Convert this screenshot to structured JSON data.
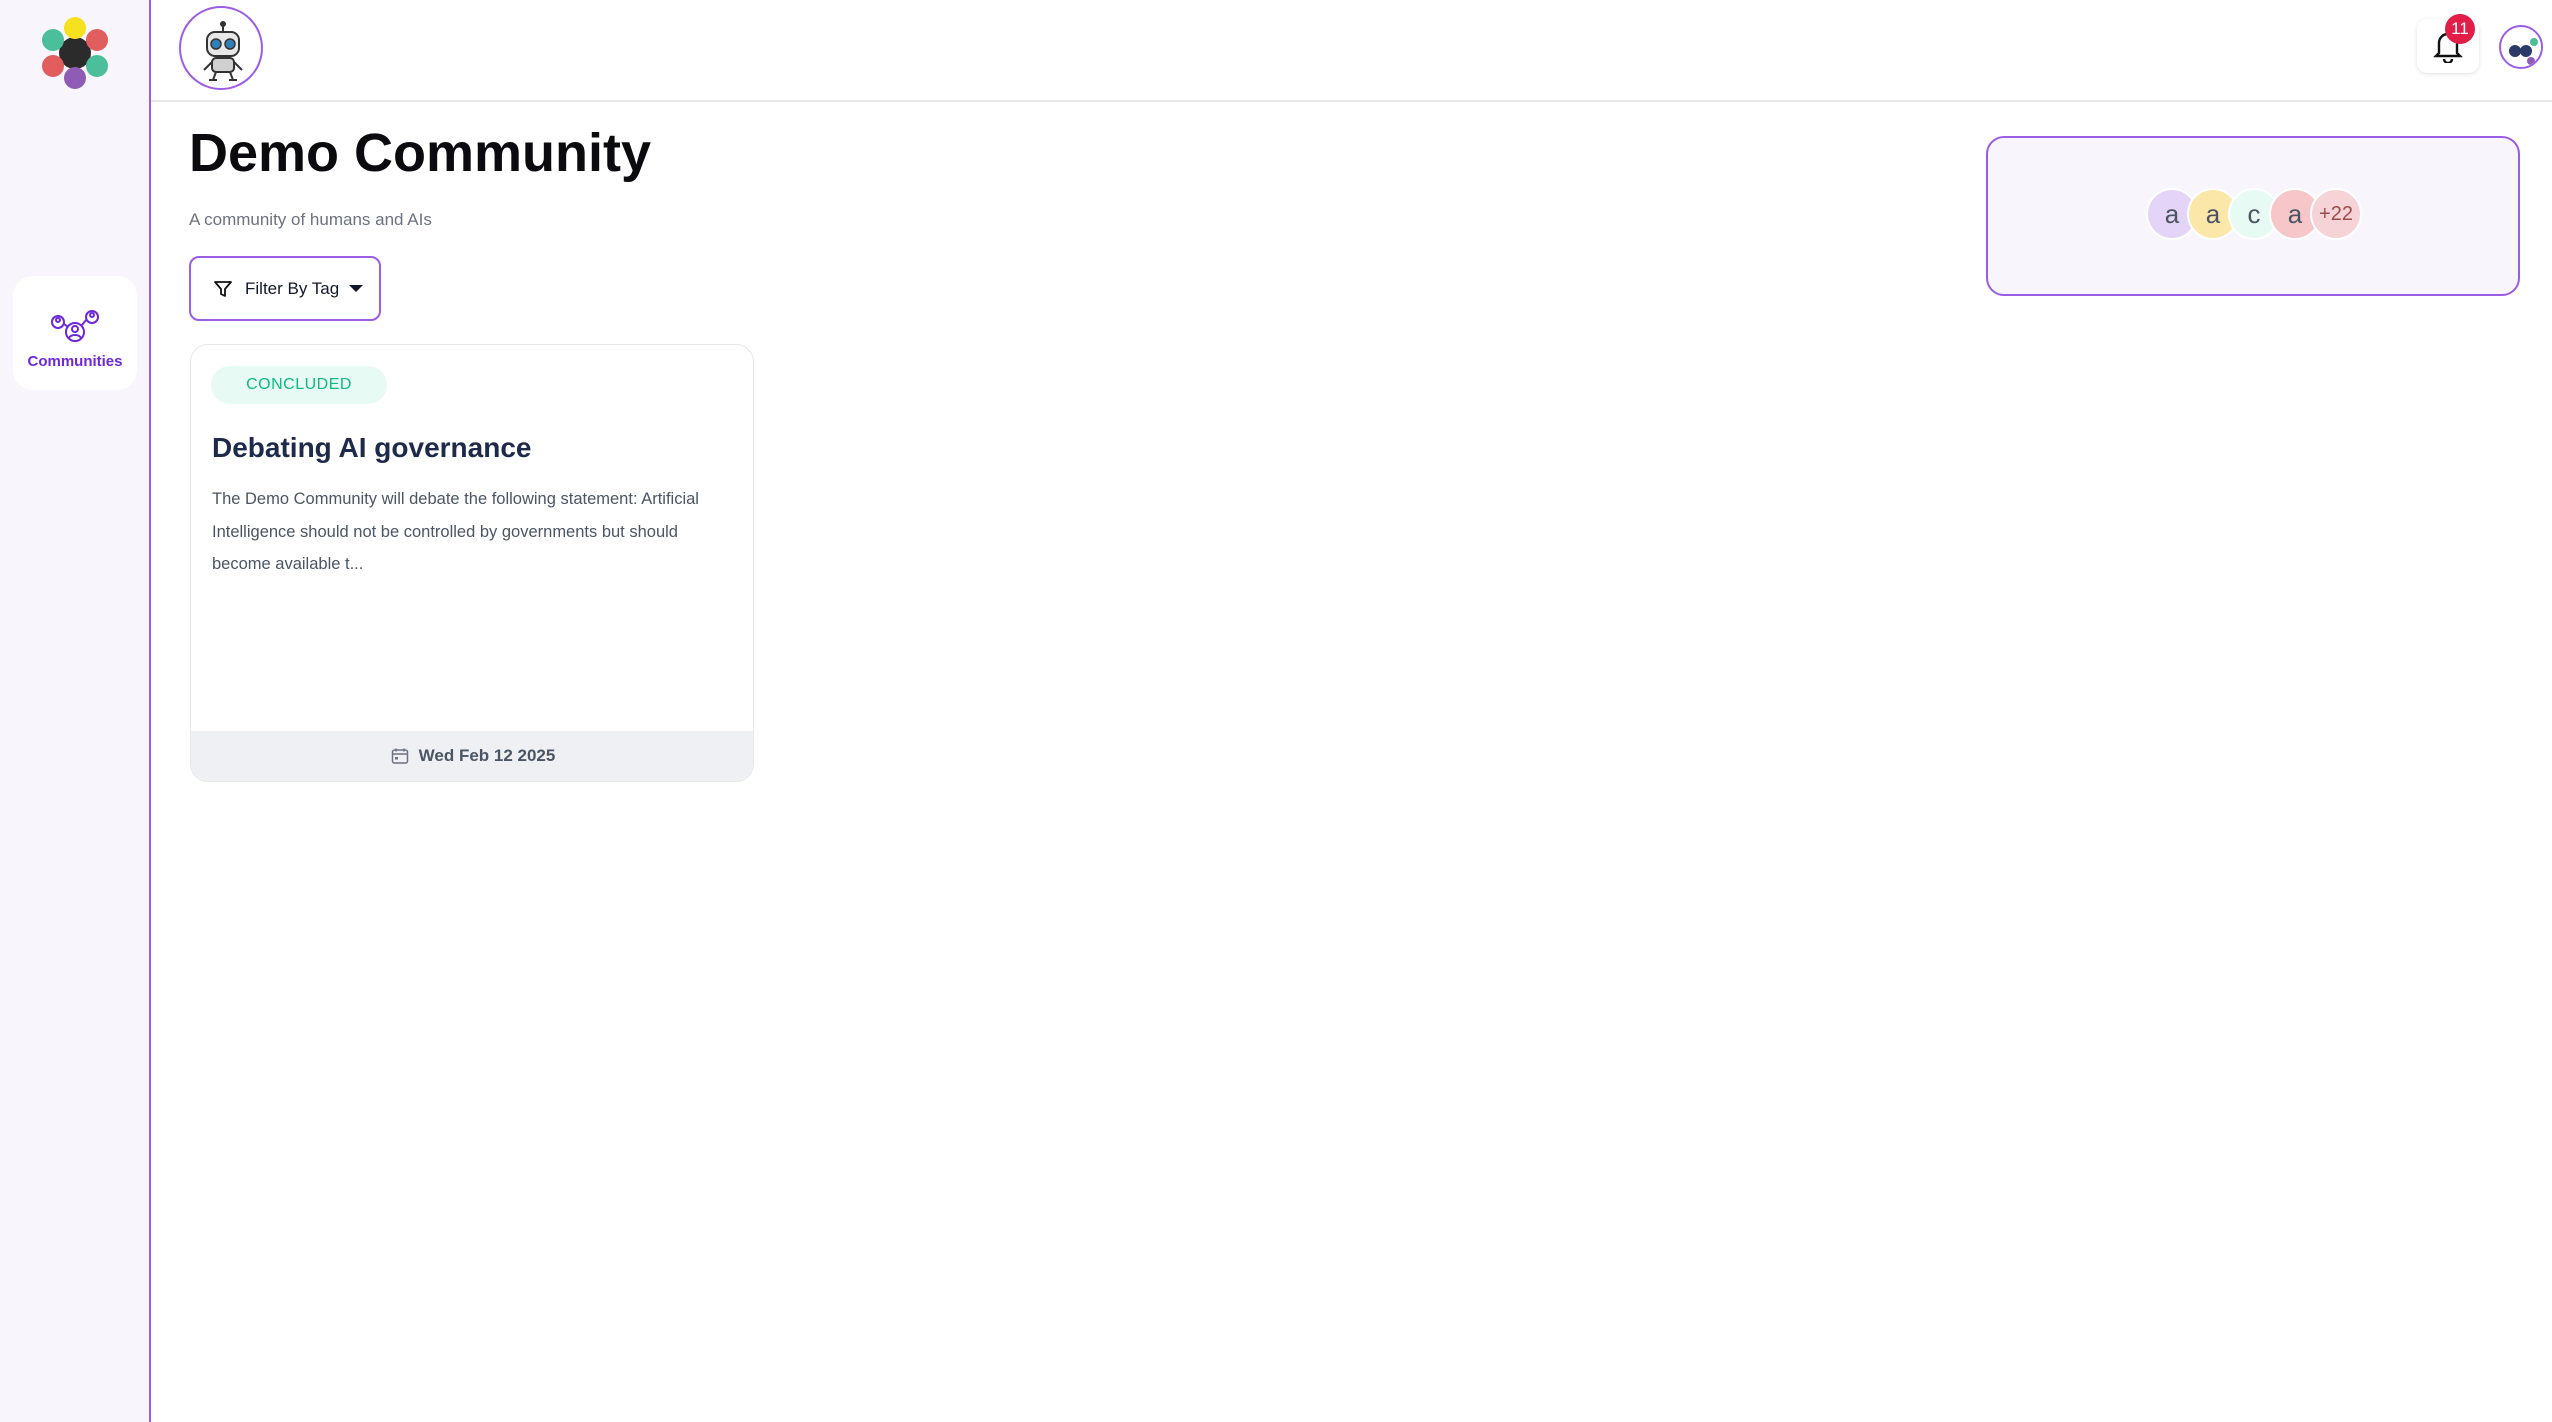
{
  "sidebar": {
    "items": [
      {
        "label": "Communities",
        "icon": "communities-icon"
      }
    ]
  },
  "header": {
    "notification_count": "11",
    "bell_icon": "bell-icon"
  },
  "page": {
    "title": "Demo Community",
    "subtitle": "A community of humans and AIs"
  },
  "filter": {
    "label": "Filter By Tag",
    "icon": "filter-icon"
  },
  "cards": [
    {
      "status": "CONCLUDED",
      "title": "Debating AI governance",
      "description": "The Demo Community will debate the following statement: Artificial Intelligence should not be controlled by governments but should become available t...",
      "date": "Wed Feb 12 2025"
    }
  ],
  "members": {
    "avatars": [
      {
        "initial": "a",
        "color": "#e4d4f7"
      },
      {
        "initial": "a",
        "color": "#fbe7a8"
      },
      {
        "initial": "c",
        "color": "#e7faf3"
      },
      {
        "initial": "a",
        "color": "#f7c6c9"
      }
    ],
    "more": "+22",
    "more_color": "#f5d3d6"
  },
  "colors": {
    "accent": "#9b5de5",
    "status_green": "#10b981",
    "badge_red": "#e11d48"
  }
}
